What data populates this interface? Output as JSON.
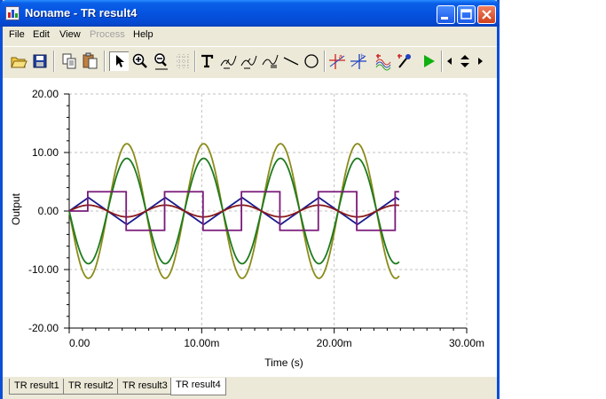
{
  "window": {
    "title": "Noname - TR result4"
  },
  "menu": {
    "file": "File",
    "edit": "Edit",
    "view": "View",
    "process": "Process",
    "help": "Help"
  },
  "toolbar": {
    "icons": [
      "open-folder-icon",
      "save-disk-icon",
      "copy-icon",
      "paste-icon",
      "pointer-icon",
      "zoom-in-icon",
      "zoom-out-icon",
      "grid-icon",
      "text-icon",
      "marker-icon",
      "marker2-icon",
      "legend-icon",
      "line-icon",
      "ellipse-icon",
      "cursor-a-icon",
      "cursor-b-icon",
      "curves-icon",
      "pick-icon",
      "run-icon",
      "left-icon",
      "updown-icon",
      "right-icon"
    ]
  },
  "tabs": [
    "TR result1",
    "TR result2",
    "TR result3",
    "TR result4"
  ],
  "active_tab": 3,
  "colors": {
    "sine_large": "#8b8b1a",
    "sine_medium": "#1e7a1e",
    "sine_small": "#8b1a1a",
    "triangle": "#1a1a8b",
    "square": "#7a1a7a",
    "grid": "#c0c0c0"
  },
  "chart_data": {
    "type": "line",
    "title": "",
    "xlabel": "Time (s)",
    "ylabel": "Output",
    "xlim": [
      0,
      0.03
    ],
    "ylim": [
      -20,
      20
    ],
    "x_ticks": [
      {
        "value": 0,
        "label": "0.00"
      },
      {
        "value": 0.01,
        "label": "10.00m"
      },
      {
        "value": 0.02,
        "label": "20.00m"
      },
      {
        "value": 0.03,
        "label": "30.00m"
      }
    ],
    "y_ticks": [
      {
        "value": 20,
        "label": "20.00"
      },
      {
        "value": 10,
        "label": "10.00"
      },
      {
        "value": 0,
        "label": "0.00"
      },
      {
        "value": -10,
        "label": "-10.00"
      },
      {
        "value": -20,
        "label": "-20.00"
      }
    ],
    "grid": true,
    "series": [
      {
        "kind": "sine",
        "amplitude": 11.5,
        "period": 0.0058,
        "phase": 0,
        "t_end": 0.0249
      },
      {
        "kind": "sine",
        "amplitude": 9.0,
        "period": 0.0058,
        "phase": 0,
        "t_end": 0.0249
      },
      {
        "kind": "triangle",
        "amplitude": 2.3,
        "period": 0.0058,
        "t_end": 0.0249
      },
      {
        "kind": "sine",
        "amplitude": 1.0,
        "period": 0.0058,
        "phase": 3.14159,
        "t_end": 0.0249
      },
      {
        "kind": "square",
        "amplitude": 3.3,
        "period": 0.0058,
        "offset": 0.0014,
        "t_end": 0.0249
      }
    ]
  }
}
